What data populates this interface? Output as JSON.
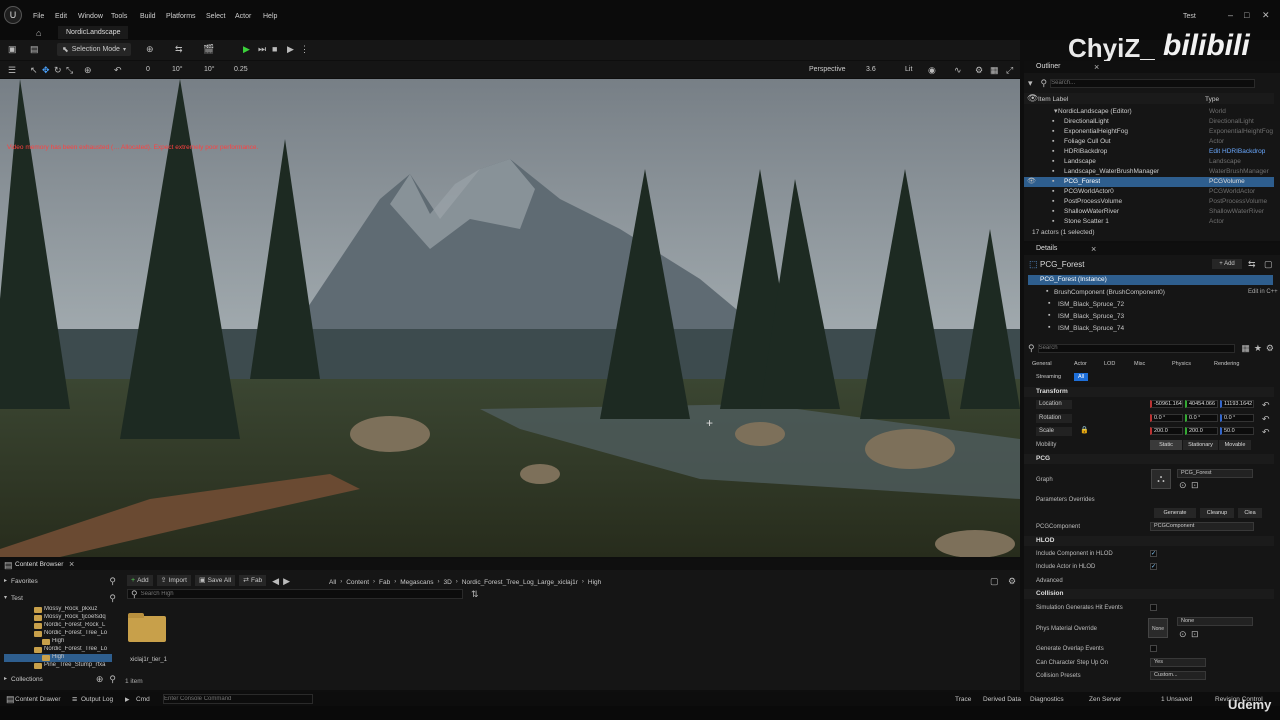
{
  "window": {
    "title": "Test"
  },
  "menu": [
    "File",
    "Edit",
    "Window",
    "Tools",
    "Build",
    "Platforms",
    "Select",
    "Actor",
    "Help"
  ],
  "level_tab": "NordicLandscape",
  "toolbar": {
    "mode": "Selection Mode"
  },
  "viewport_bar": {
    "snap_move": "0",
    "snap_rot": "10°",
    "snap_rot2": "10°",
    "snap_scale": "0.25",
    "view_type": "Perspective",
    "cam_speed": "3.6",
    "lit": "Lit"
  },
  "viewport": {
    "warning": "Video memory has been exhausted (… Allocated). Expect extremely poor performance."
  },
  "watermark": {
    "user": "ChyiZ_",
    "site": "bilibili",
    "udemy": "Udemy"
  },
  "outliner": {
    "title": "Outliner",
    "search_placeholder": "Search...",
    "col_label": "Item Label",
    "col_type": "Type",
    "rows": [
      {
        "name": "NordicLandscape (Editor)",
        "type": "World"
      },
      {
        "name": "DirectionalLight",
        "type": "DirectionalLight"
      },
      {
        "name": "ExponentialHeightFog",
        "type": "ExponentialHeightFog"
      },
      {
        "name": "Foliage Cull Out",
        "type": "Actor"
      },
      {
        "name": "HDRIBackdrop",
        "type": "Edit HDRIBackdrop"
      },
      {
        "name": "Landscape",
        "type": "Landscape"
      },
      {
        "name": "Landscape_WaterBrushManager",
        "type": "WaterBrushManager"
      },
      {
        "name": "PCG_Forest",
        "type": "PCGVolume"
      },
      {
        "name": "PCGWorldActor0",
        "type": "PCGWorldActor"
      },
      {
        "name": "PostProcessVolume",
        "type": "PostProcessVolume"
      },
      {
        "name": "ShallowWaterRiver",
        "type": "ShallowWaterRiver"
      },
      {
        "name": "Stone Scatter 1",
        "type": "Actor"
      }
    ],
    "status": "17 actors (1 selected)"
  },
  "details": {
    "title": "Details",
    "actor_name": "PCG_Forest",
    "add_label": "+ Add",
    "instance": "PCG_Forest (Instance)",
    "components": [
      {
        "name": "BrushComponent (BrushComponent0)",
        "extra": "Edit in C++"
      },
      {
        "name": "ISM_Black_Spruce_72",
        "extra": ""
      },
      {
        "name": "ISM_Black_Spruce_73",
        "extra": ""
      },
      {
        "name": "ISM_Black_Spruce_74",
        "extra": ""
      }
    ],
    "search_placeholder": "Search",
    "filter_tabs": [
      "General",
      "Actor",
      "LOD",
      "Misc",
      "Physics",
      "Rendering"
    ],
    "filter_tabs2": [
      "Streaming",
      "All"
    ],
    "transform": {
      "section": "Transform",
      "location_label": "Location",
      "rotation_label": "Rotation",
      "scale_label": "Scale",
      "location": [
        "-50961.164",
        "40454.066",
        "11193.1642"
      ],
      "rotation": [
        "0.0 °",
        "0.0 °",
        "0.0 °"
      ],
      "scale": [
        "200.0",
        "200.0",
        "50.0"
      ],
      "mobility_label": "Mobility",
      "mobility": [
        "Static",
        "Stationary",
        "Movable"
      ]
    },
    "pcg": {
      "section": "PCG",
      "graph_label": "Graph",
      "graph_value": "PCG_Forest",
      "overrides_label": "Parameters Overrides",
      "generate": "Generate",
      "cleanup": "Cleanup",
      "clear": "Clea",
      "component_label": "PCGComponent",
      "component_value": "PCGComponent"
    },
    "hlod": {
      "section": "HLOD",
      "include_component": "Include Component in HLOD",
      "include_actor": "Include Actor in HLOD",
      "advanced": "Advanced"
    },
    "collision": {
      "section": "Collision",
      "sim_hit": "Simulation Generates Hit Events",
      "phys_mat": "Phys Material Override",
      "phys_mat_value": "None",
      "phys_thumb": "None",
      "overlap": "Generate Overlap Events",
      "step_up": "Can Character Step Up On",
      "step_up_value": "Yes",
      "presets": "Collision Presets",
      "presets_value": "Custom..."
    }
  },
  "content_browser": {
    "tab": "Content Browser",
    "add": "Add",
    "import": "Import",
    "save_all": "Save All",
    "fab": "Fab",
    "path": [
      "All",
      "Content",
      "Fab",
      "Megascans",
      "3D",
      "Nordic_Forest_Tree_Log_Large_xiclaj1r",
      "High"
    ],
    "search_placeholder": "Search High",
    "favorites": "Favorites",
    "tree_root": "Test",
    "tree_items": [
      "Mossy_Rock_pkxuz",
      "Mossy_Rock_tjcoefsdq",
      "Nordic_Forest_Rock_L",
      "Nordic_Forest_Tree_Lo",
      "High",
      "Nordic_Forest_Tree_Lo",
      "High",
      "Pine_Tree_Stump_rfxa"
    ],
    "collections": "Collections",
    "asset_name": "xiclaj1r_tier_1",
    "item_count": "1 item"
  },
  "bottom_bar": {
    "content_drawer": "Content Drawer",
    "output_log": "Output Log",
    "cmd": "Cmd",
    "console_placeholder": "Enter Console Command",
    "trace": "Trace",
    "derived": "Derived Data",
    "diagnostics": "Diagnostics",
    "zen": "Zen Server",
    "unsaved": "1 Unsaved",
    "revision": "Revision Control"
  }
}
